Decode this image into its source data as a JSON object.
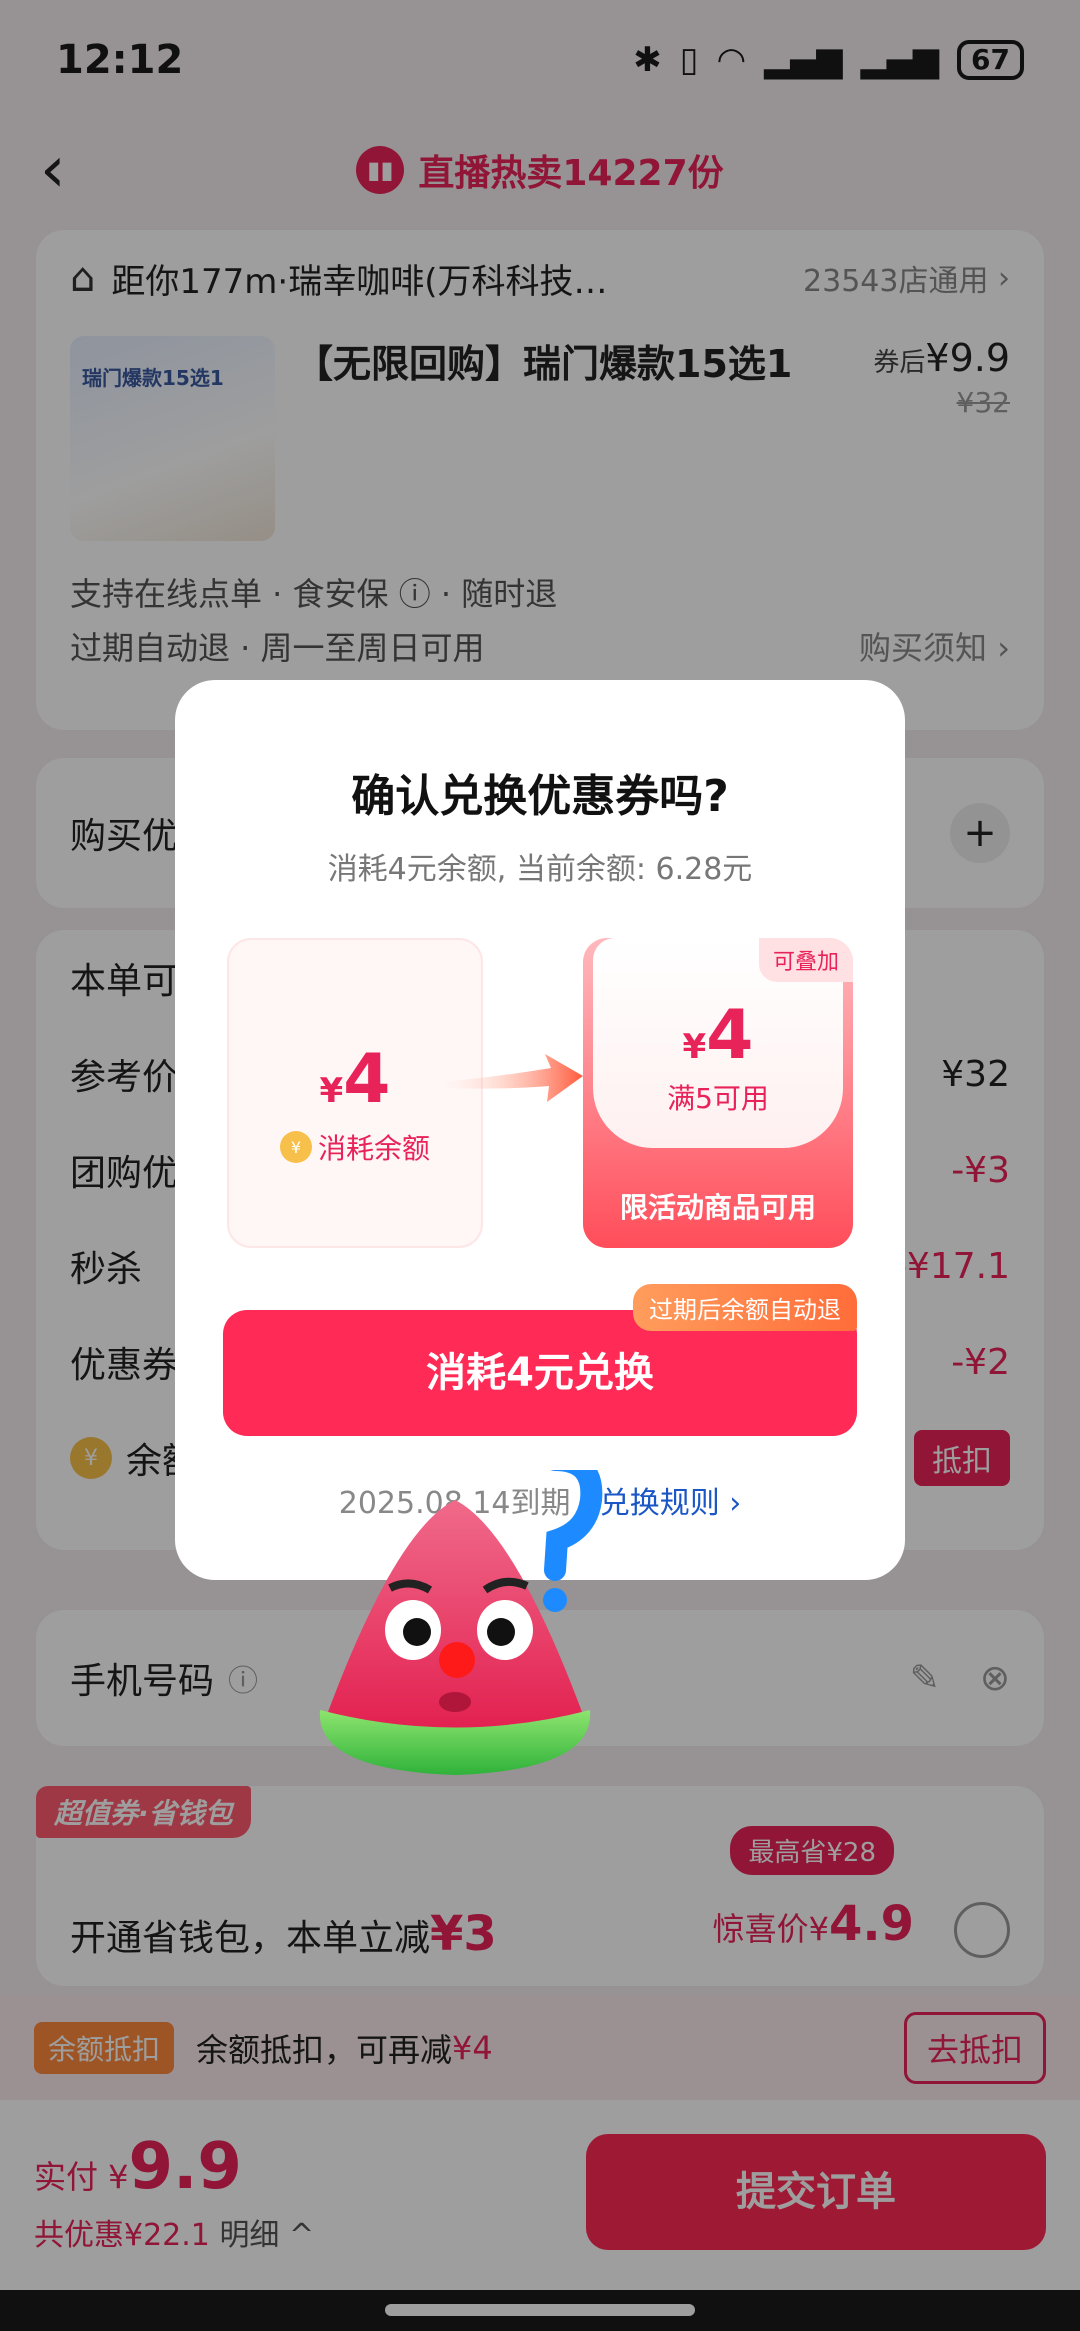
{
  "status": {
    "time": "12:12",
    "battery": "67"
  },
  "nav": {
    "hot_text": "直播热卖14227份"
  },
  "store": {
    "name": "距你177m·瑞幸咖啡(万科科技…",
    "count": "23543店通用"
  },
  "product": {
    "title": "【无限回购】瑞门爆款15选1",
    "thumb_title": "瑞门爆款15选1",
    "after_label": "券后",
    "price": "¥9.9",
    "orig": "¥32"
  },
  "tags": {
    "line1": "支持在线点单 · 食安保 ⓘ · 随时退",
    "line2": "过期自动退 · 周一至周日可用",
    "notice": "购买须知"
  },
  "sections": {
    "buy": "购买优惠",
    "order_label": "本单可享",
    "ref": {
      "label": "参考价",
      "value": "¥32"
    },
    "group": {
      "label": "团购优惠",
      "value": "-¥3"
    },
    "flash": {
      "label": "秒杀",
      "value": "-¥17.1"
    },
    "coupon": {
      "label": "优惠券",
      "value": "-¥2"
    },
    "balance": {
      "label": "余额",
      "btn": "抵扣"
    },
    "phone": "手机号码"
  },
  "wallet": {
    "badge": "超值券·省钱包",
    "text": "开通省钱包，本单立减",
    "amount": "¥3",
    "max_save": "最高省¥28",
    "surprise": "惊喜价¥",
    "surprise_price": "4.9"
  },
  "strip": {
    "badge": "余额抵扣",
    "text": "余额抵扣，可再减",
    "amount": "¥4",
    "btn": "去抵扣"
  },
  "bottom": {
    "pay_label": "实付 ¥",
    "pay": "9.9",
    "saved": "共优惠¥22.1",
    "detail": "明细 ^",
    "submit": "提交订单"
  },
  "modal": {
    "title": "确认兑换优惠券吗?",
    "subtitle": "消耗4元余额, 当前余额: 6.28元",
    "left_amount": "4",
    "left_label": "消耗余额",
    "right_badge": "可叠加",
    "right_amount": "4",
    "right_cond": "满5可用",
    "right_foot": "限活动商品可用",
    "auto_tag": "过期后余额自动退",
    "button": "消耗4元兑换",
    "expire": "2025.08.14到期",
    "rule": "兑换规则 ›"
  },
  "colors": {
    "accent": "#ff2a55",
    "brand_red": "#e8235a",
    "link": "#1a56c6"
  }
}
